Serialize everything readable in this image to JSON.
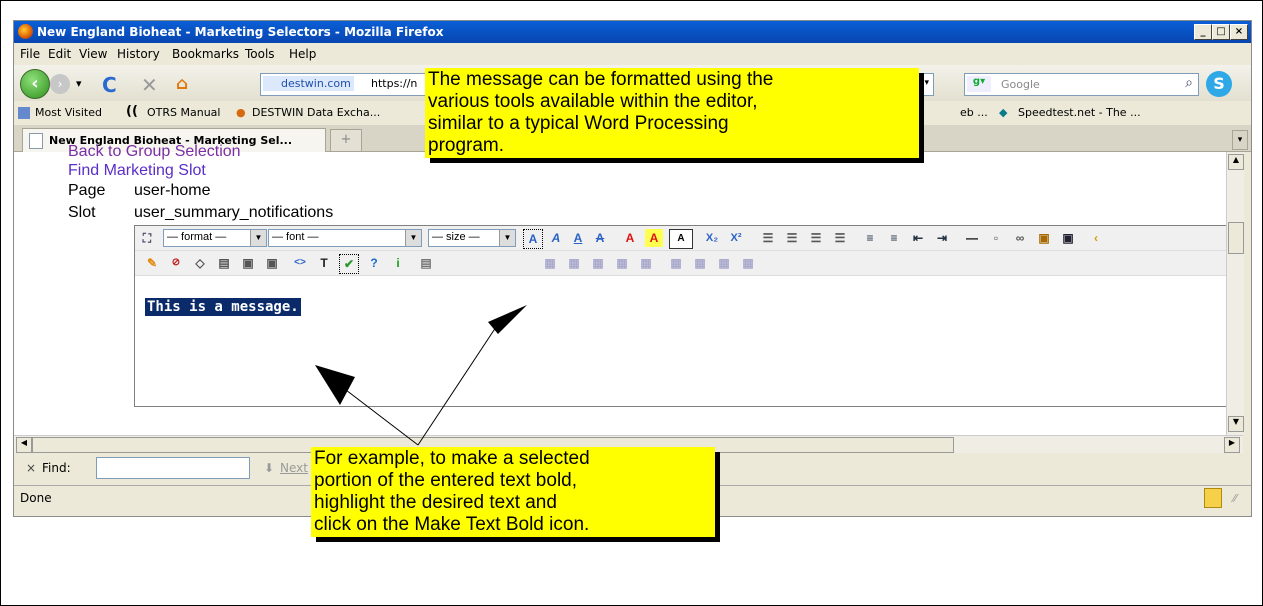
{
  "window": {
    "title": "New England Bioheat - Marketing Selectors - Mozilla Firefox",
    "controls": [
      "_",
      "□",
      "×"
    ]
  },
  "menu": [
    "File",
    "Edit",
    "View",
    "History",
    "Bookmarks",
    "Tools",
    "Help"
  ],
  "nav": {
    "site_label": "destwin.com",
    "url": "https://n",
    "search_placeholder": "Google"
  },
  "bookmarks": [
    "Most Visited",
    "OTRS Manual",
    "DESTWIN Data Excha...",
    "eb ...",
    "Speedtest.net - The ..."
  ],
  "tab": {
    "label": "New England Bioheat - Marketing Sel...",
    "new_tab": "+"
  },
  "page": {
    "back_link": "Back to Group Selection",
    "find_link": "Find Marketing Slot",
    "page_label": "Page",
    "page_value": "user-home",
    "slot_label": "Slot",
    "slot_value": "user_summary_notifications"
  },
  "editor": {
    "format_select": "— format —",
    "font_select": "— font —",
    "size_select": "— size —",
    "content": "This is a message."
  },
  "find": {
    "label": "Find:",
    "next_label": "Next"
  },
  "status": {
    "text": "Done"
  },
  "callouts": {
    "top": [
      "The message can be formatted using the",
      "various tools available within the editor,",
      "similar to a typical Word Processing",
      "program."
    ],
    "bottom": [
      "For example, to make a selected",
      "portion of the entered text bold,",
      "highlight the desired text and",
      "click on the Make Text Bold icon."
    ]
  }
}
